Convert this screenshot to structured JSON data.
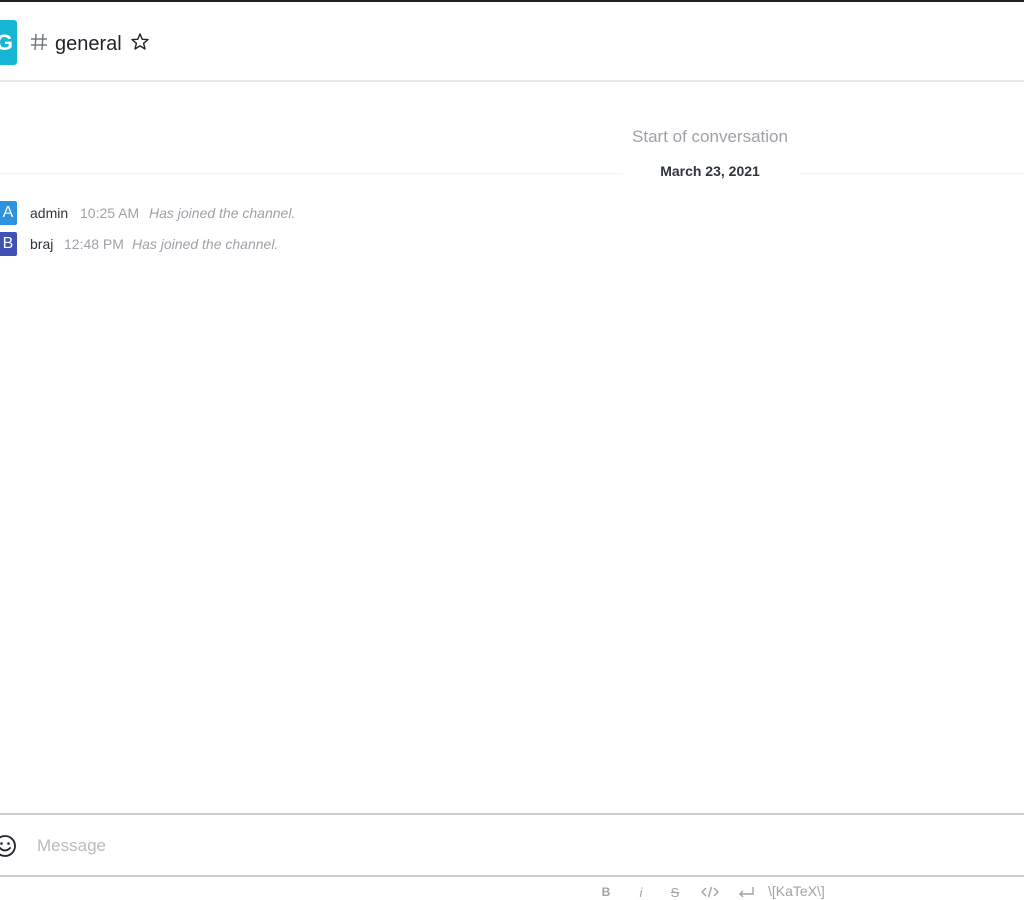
{
  "header": {
    "room_avatar_letter": "G",
    "room_name": "general"
  },
  "conversation": {
    "start_label": "Start of conversation",
    "date": "March 23, 2021",
    "messages": [
      {
        "avatar_letter": "A",
        "avatar_color": "#2d92e0",
        "user": "admin",
        "time": "10:25 AM",
        "text": "Has joined the channel."
      },
      {
        "avatar_letter": "B",
        "avatar_color": "#3f51b5",
        "user": "braj",
        "time": "12:48 PM",
        "text": "Has joined the channel."
      }
    ]
  },
  "composer": {
    "placeholder": "Message"
  },
  "toolbar": {
    "bold": "B",
    "italic": "i",
    "strike": "S",
    "katex": "\\[KaTeX\\]"
  },
  "icons": {
    "room": "hash-icon",
    "favorite": "star-icon",
    "emoji": "emoji-icon",
    "code": "code-icon",
    "multiline": "return-icon"
  },
  "colors": {
    "room_avatar": "#17b5d4",
    "muted_text": "#9ea2a8"
  }
}
